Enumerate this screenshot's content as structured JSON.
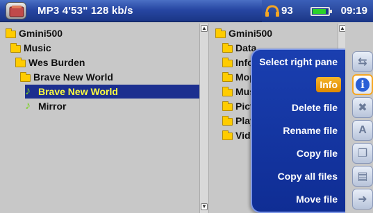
{
  "topbar": {
    "title": "MP3 4'53\" 128 kb/s",
    "volume": "93",
    "battery_level": 0.8,
    "clock": "09:19"
  },
  "left_pane": {
    "items": [
      {
        "label": "Gmini500",
        "icon": "folder-icon",
        "indent": 0
      },
      {
        "label": "Music",
        "icon": "folder-icon",
        "indent": 1
      },
      {
        "label": "Wes Burden",
        "icon": "folder-icon",
        "indent": 2
      },
      {
        "label": "Brave New World",
        "icon": "folder-icon",
        "indent": 3
      },
      {
        "label": "Brave New World",
        "icon": "music-note-icon",
        "indent": 4,
        "selected": true
      },
      {
        "label": "Mirror",
        "icon": "music-note-icon",
        "indent": 4
      }
    ]
  },
  "right_pane": {
    "items": [
      {
        "label": "Gmini500",
        "icon": "folder-icon",
        "indent": 0
      },
      {
        "label": "Data",
        "icon": "folder-icon",
        "indent": 1
      },
      {
        "label": "Info",
        "icon": "folder-icon",
        "indent": 1
      },
      {
        "label": "Moph",
        "icon": "folder-icon",
        "indent": 1
      },
      {
        "label": "Musi",
        "icon": "folder-icon",
        "indent": 1
      },
      {
        "label": "Pictu",
        "icon": "folder-icon",
        "indent": 1
      },
      {
        "label": "Playl",
        "icon": "folder-icon",
        "indent": 1
      },
      {
        "label": "Vide",
        "icon": "folder-icon",
        "indent": 1
      }
    ]
  },
  "menu": {
    "items": [
      {
        "label": "Select right pane"
      },
      {
        "label": "Info",
        "active": true
      },
      {
        "label": "Delete file"
      },
      {
        "label": "Rename file"
      },
      {
        "label": "Copy file"
      },
      {
        "label": "Copy all files"
      },
      {
        "label": "Move file"
      }
    ]
  },
  "side_buttons": [
    {
      "icon": "switch-pane-icon"
    },
    {
      "icon": "info-icon",
      "active": true
    },
    {
      "icon": "delete-icon"
    },
    {
      "icon": "rename-icon"
    },
    {
      "icon": "copy-icon"
    },
    {
      "icon": "copy-all-icon"
    },
    {
      "icon": "move-icon"
    }
  ]
}
